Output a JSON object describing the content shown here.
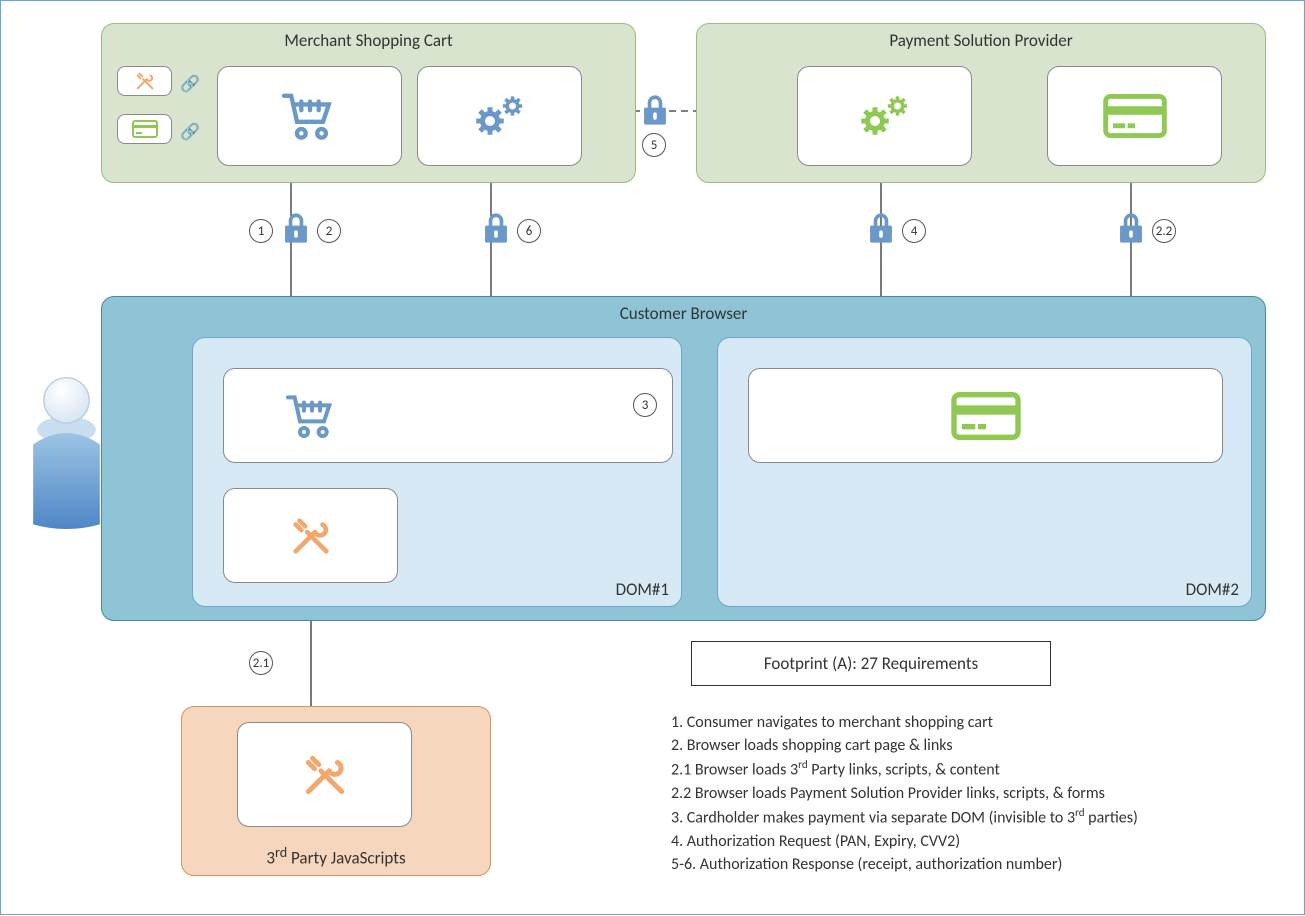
{
  "boxes": {
    "merchant_title": "Merchant Shopping Cart",
    "provider_title": "Payment Solution Provider",
    "browser_title": "Customer Browser",
    "thirdparty_title": "3",
    "thirdparty_title_rest": " Party JavaScripts",
    "rd": "rd",
    "dom1": "DOM#1",
    "dom2": "DOM#2"
  },
  "steps": {
    "s1": "1",
    "s2": "2",
    "s2_1": "2.1",
    "s2_2": "2.2",
    "s3": "3",
    "s4": "4",
    "s5": "5",
    "s6": "6"
  },
  "footprint": "Footprint (A): 27 Requirements",
  "legend": [
    {
      "n": "1.",
      "text": "Consumer navigates to merchant shopping cart",
      "sup": null
    },
    {
      "n": "2.",
      "text": "Browser loads shopping cart page & links",
      "sup": null
    },
    {
      "n": "2.1",
      "text": "Browser loads 3",
      "sup": "rd",
      "rest": " Party links, scripts, & content"
    },
    {
      "n": "2.2",
      "text": "Browser loads Payment Solution Provider links, scripts, & forms",
      "sup": null
    },
    {
      "n": "3.",
      "text": "Cardholder makes payment via separate DOM (invisible to 3",
      "sup": "rd",
      "rest": " parties)"
    },
    {
      "n": "4.",
      "text": "Authorization Request (PAN, Expiry, CVV2)",
      "sup": null
    },
    {
      "n": "5-6.",
      "text": "Authorization Response (receipt, authorization number)",
      "sup": null
    }
  ],
  "colors": {
    "blue": "#6a98c8",
    "green": "#8fc954",
    "orange": "#f2a76d"
  }
}
